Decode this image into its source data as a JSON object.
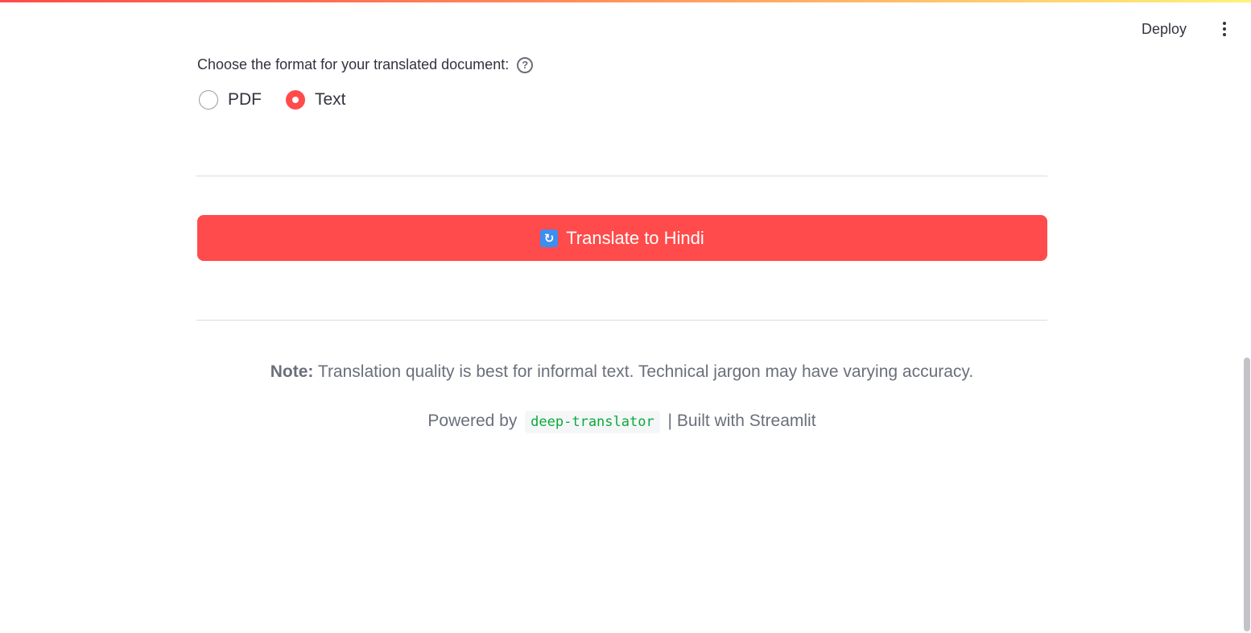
{
  "header": {
    "deploy_label": "Deploy",
    "menu_icon": "kebab-menu-icon"
  },
  "format_select": {
    "label": "Choose the format for your translated document:",
    "help_icon": "question-circle-icon",
    "help_glyph": "?",
    "options": [
      {
        "label": "PDF",
        "checked": false
      },
      {
        "label": "Text",
        "checked": true
      }
    ]
  },
  "translate_button": {
    "icon": "arrows-counterclockwise-icon",
    "icon_glyph": "↻",
    "label": "Translate to Hindi"
  },
  "note": {
    "prefix": "Note:",
    "text": " Translation quality is best for informal text. Technical jargon may have varying accuracy."
  },
  "footer": {
    "powered_by": "Powered by",
    "library": "deep-translator",
    "built_with": "| Built with Streamlit"
  },
  "colors": {
    "primary": "#ff4b4b",
    "code_text": "#09ab3b",
    "muted_text": "#6b6f7b"
  }
}
